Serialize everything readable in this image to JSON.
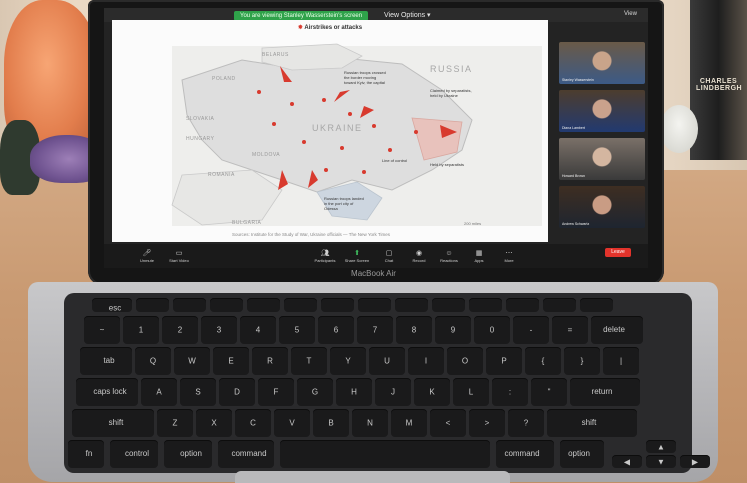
{
  "laptop": {
    "brand": "MacBook Air"
  },
  "zoom": {
    "share_banner": "You are viewing Stanley Wasserstein's screen",
    "view_options": "View Options ▾",
    "view_button": "View",
    "leave_label": "Leave",
    "toolbar": [
      {
        "icon": "microphone-icon",
        "label": "Unmute"
      },
      {
        "icon": "camera-icon",
        "label": "Start Video"
      },
      {
        "icon": "participants-icon",
        "label": "Participants"
      },
      {
        "icon": "share-screen-icon",
        "label": "Share Screen"
      },
      {
        "icon": "chat-icon",
        "label": "Chat"
      },
      {
        "icon": "record-icon",
        "label": "Record"
      },
      {
        "icon": "reactions-icon",
        "label": "Reactions"
      },
      {
        "icon": "apps-icon",
        "label": "Apps"
      },
      {
        "icon": "more-icon",
        "label": "More"
      }
    ],
    "participants": [
      {
        "name": "Stanley Wasserstein",
        "bg": "#6a5a48",
        "shirt": "#3c5a86"
      },
      {
        "name": "Diana Lambert",
        "bg": "#4d3d2e",
        "shirt": "#223a70"
      },
      {
        "name": "Howard Brown",
        "bg": "#7a7068",
        "shirt": "#3a3a3a"
      },
      {
        "name": "Andrew Schwartz",
        "bg": "#3e2e22",
        "shirt": "#1e2530"
      }
    ]
  },
  "map_slide": {
    "title": "Airstrikes or attacks",
    "countries": [
      "BELARUS",
      "POLAND",
      "RUSSIA",
      "SLOVAKIA",
      "HUNGARY",
      "MOLDOVA",
      "ROMANIA",
      "UKRAINE",
      "BULGARIA"
    ],
    "notes": [
      "Russian troops crossed the border moving toward Kyiv, the capital",
      "Claimed by separatists, held by Ukraine",
      "Line of control",
      "Held by separatists",
      "Russian troops landed in the port city of Odessa"
    ],
    "source": "Sources: Institute for the Study of War, Ukraine officials — The New York Times",
    "legend": "200 miles"
  },
  "keyboard": {
    "row0": [
      "esc",
      "",
      "",
      "",
      "",
      "",
      "",
      "",
      "",
      "",
      "",
      "",
      "",
      ""
    ],
    "row1": [
      "~",
      "1",
      "2",
      "3",
      "4",
      "5",
      "6",
      "7",
      "8",
      "9",
      "0",
      "-",
      "=",
      "delete"
    ],
    "row2": [
      "tab",
      "Q",
      "W",
      "E",
      "R",
      "T",
      "Y",
      "U",
      "I",
      "O",
      "P",
      "{",
      "}",
      "|"
    ],
    "row3": [
      "caps lock",
      "A",
      "S",
      "D",
      "F",
      "G",
      "H",
      "J",
      "K",
      "L",
      ":",
      "\"",
      "return"
    ],
    "row4": [
      "shift",
      "Z",
      "X",
      "C",
      "V",
      "B",
      "N",
      "M",
      "<",
      ">",
      "?",
      "shift"
    ],
    "row5": [
      "fn",
      "control",
      "option",
      "command",
      "",
      "command",
      "option",
      "◀",
      "▲",
      "▼",
      "▶"
    ]
  }
}
